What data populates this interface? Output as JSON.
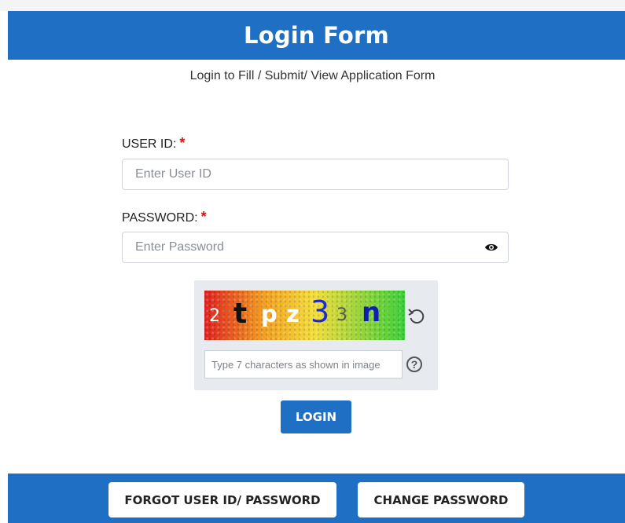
{
  "header": {
    "title": "Login Form"
  },
  "subtitle": "Login to Fill / Submit/ View Application Form",
  "user_id": {
    "label": "USER ID:",
    "required": "*",
    "placeholder": "Enter User ID",
    "value": ""
  },
  "password": {
    "label": "PASSWORD:",
    "required": "*",
    "placeholder": "Enter Password",
    "value": "",
    "toggle_icon": "eye-icon"
  },
  "captcha": {
    "characters": [
      "2",
      "t",
      "p",
      "z",
      "3",
      "3",
      "n"
    ],
    "refresh_icon": "refresh-icon",
    "placeholder": "Type 7 characters as shown in image",
    "help_symbol": "?"
  },
  "login_button": "LOGIN",
  "footer": {
    "forgot_label": "FORGOT USER ID/ PASSWORD",
    "change_label": "CHANGE PASSWORD"
  },
  "colors": {
    "primary": "#1f6fc4",
    "required": "#dd1111",
    "captcha_bg": "#e7ebef"
  }
}
